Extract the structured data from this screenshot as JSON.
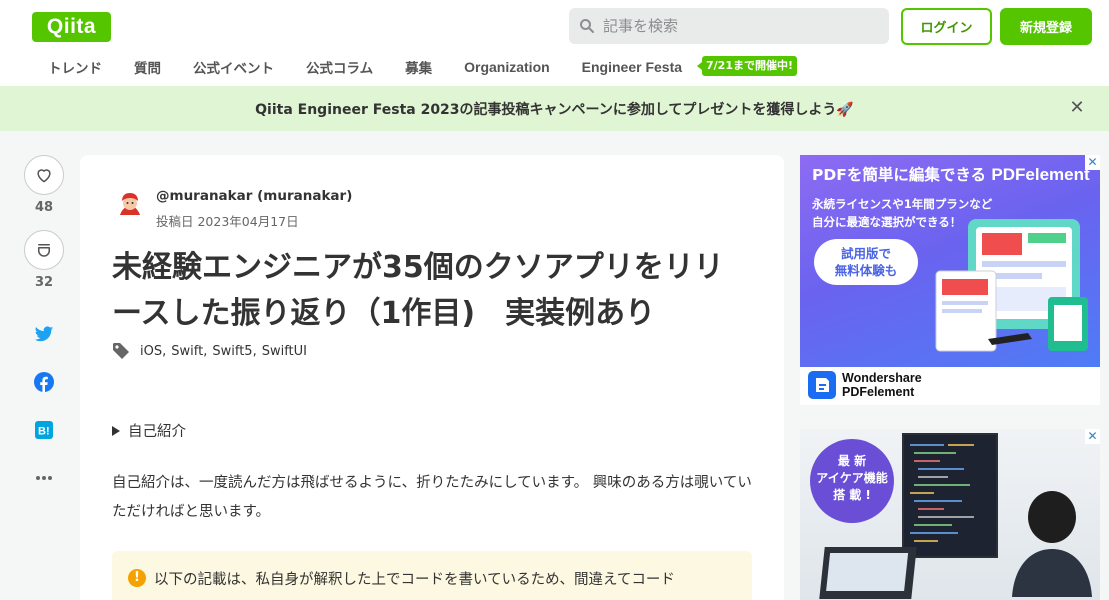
{
  "header": {
    "logo": "Qiita",
    "search_placeholder": "記事を検索",
    "login": "ログイン",
    "signup": "新規登録"
  },
  "nav": {
    "items": [
      "トレンド",
      "質問",
      "公式イベント",
      "公式コラム",
      "募集",
      "Organization",
      "Engineer Festa"
    ],
    "festa_badge": "7/21まで開催中!"
  },
  "banner": {
    "text": "Qiita Engineer Festa 2023の記事投稿キャンペーンに参加してプレゼントを獲得しよう🚀"
  },
  "rail": {
    "likes": "48",
    "stocks": "32"
  },
  "article": {
    "author": "@muranakar (muranakar)",
    "posted": "投稿日 2023年04月17日",
    "title": "未経験エンジニアが35個のクソアプリをリリースした振り返り（1作目)　実装例あり",
    "tags": [
      "iOS",
      "Swift",
      "Swift5",
      "SwiftUI"
    ],
    "details_summary": "自己紹介",
    "paragraph": "自己紹介は、一度読んだ方は飛ばせるように、折りたたみにしています。 興味のある方は覗いていただければと思います。",
    "note": "以下の記載は、私自身が解釈した上でコードを書いているため、間違えてコード"
  },
  "ad1": {
    "headline_prefix": "PDFを簡単に編集できる",
    "headline_brand": "PDFelement",
    "sub1": "永続ライセンスや1年間プランなど",
    "sub2": "自分に最適な選択ができる！",
    "cta1": "試用版で",
    "cta2": "無料体験も",
    "brand1": "Wondershare",
    "brand2": "PDFelement"
  },
  "ad2": {
    "badge1": "最 新",
    "badge2": "アイケア機能",
    "badge3": "搭 載 !"
  },
  "colors": {
    "brand": "#55c500",
    "banner_bg": "#e0f5d4",
    "note_bg": "#fdf8e2",
    "warning": "#f5a100"
  }
}
